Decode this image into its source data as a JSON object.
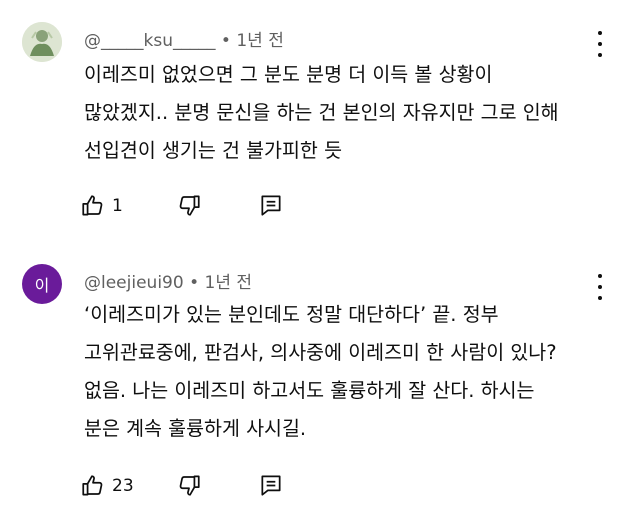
{
  "comments": [
    {
      "author": "@_____ksu_____",
      "time": "1년 전",
      "avatar_initial": "",
      "text": "이레즈미 없었으면 그 분도 분명 더 이득 볼 상황이\n많았겠지.. 분명 문신을 하는 건 본인의 자유지만 그로 인해\n선입견이 생기는 건 불가피한 듯",
      "likes": "1"
    },
    {
      "author": "@leejieui90",
      "time": "1년 전",
      "avatar_initial": "이",
      "avatar_color": "#6a1b9a",
      "text": "‘이레즈미가 있는 분인데도 정말 대단하다’ 끝. 정부\n고위관료중에, 판검사, 의사중에 이레즈미 한 사람이 있나?\n없음. 나는 이레즈미 하고서도 훌륭하게 잘 산다. 하시는\n분은 계속 훌륭하게 사시길.",
      "likes": "23"
    }
  ],
  "separator": "•",
  "icons": [
    "thumbs-up-icon",
    "thumbs-down-icon",
    "reply-icon",
    "more-vert-icon"
  ]
}
